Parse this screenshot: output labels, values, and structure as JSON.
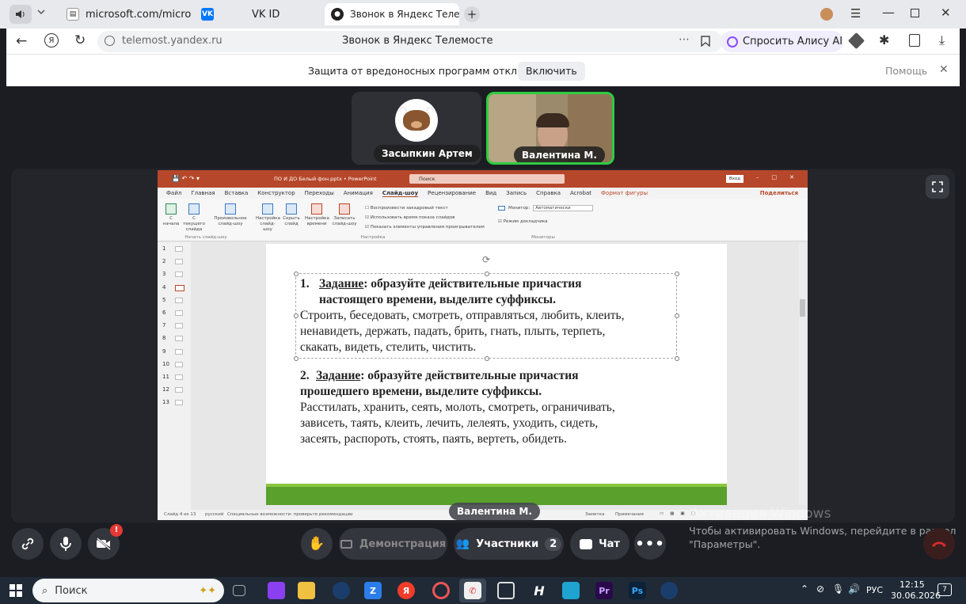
{
  "browser": {
    "tabs": [
      {
        "label": "microsoft.com/microsoft-"
      },
      {
        "label": "VK ID"
      },
      {
        "label": "Звонок в Яндекс Телеме"
      }
    ],
    "url": "telemost.yandex.ru",
    "page_title": "Звонок в Яндекс Телемосте",
    "alice_label": "Спросить Алису AI"
  },
  "notice": {
    "text": "Защита от вредоносных программ отключена",
    "enable_label": "Включить",
    "help_label": "Помощь"
  },
  "participants": [
    {
      "name": "Засыпкин Артем"
    },
    {
      "name": "Валентина М."
    }
  ],
  "presenter_label": "Валентина М.",
  "powerpoint": {
    "filename": "ПО И ДО Белый фон.pptx  •  PowerPoint",
    "search_placeholder": "Поиск",
    "login_label": "Вход",
    "menu": [
      "Файл",
      "Главная",
      "Вставка",
      "Конструктор",
      "Переходы",
      "Анимация",
      "Слайд-шоу",
      "Рецензирование",
      "Вид",
      "Запись",
      "Справка",
      "Acrobat",
      "Формат фигуры"
    ],
    "share_label": "Поделиться",
    "ribbon": {
      "btn_from_start": "С начала",
      "btn_from_current": "С текущего слайда",
      "btn_custom": "Произвольное слайд-шоу",
      "group_start": "Начать слайд-шоу",
      "btn_setup": "Настройка слайд-шоу",
      "btn_hide": "Скрыть слайд",
      "btn_rehearse": "Настройка времени",
      "btn_record": "Записать слайд-шоу",
      "check_narration": "Воспроизвести закадровый текст",
      "check_timings": "Использовать время показа слайдов",
      "check_media": "Показать элементы управления проигрывателем",
      "group_setup": "Настройка",
      "monitor_label": "Монитор:",
      "monitor_value": "Автоматически",
      "presenter_view": "Режим докладчика",
      "group_monitors": "Мониторы"
    },
    "slide_numbers": [
      "1",
      "2",
      "3",
      "4",
      "5",
      "6",
      "7",
      "8",
      "9",
      "10",
      "11",
      "12",
      "13"
    ],
    "slide": {
      "task1_num": "1.",
      "task1_word": "Задание",
      "task1_line1": ": образуйте действительные причастия",
      "task1_line2": "настоящего времени, выделите суффиксы.",
      "task1_words_1": "Строить, беседовать, смотреть, отправляться, любить, клеить,",
      "task1_words_2": "ненавидеть, держать, падать, брить, гнать, плыть, терпеть,",
      "task1_words_3": "скакать, видеть, стелить, чистить.",
      "task2_num": "2.",
      "task2_word": "Задание",
      "task2_line1": ": образуйте действительные причастия",
      "task2_line2": "прошедшего времени, выделите суффиксы.",
      "task2_words_1": "Расстилать, хранить, сеять, молоть, смотреть, ограничивать,",
      "task2_words_2": "зависеть, таять, клеить, лечить, лелеять, уходить, сидеть,",
      "task2_words_3": "засеять, распороть, стоять, паять, вертеть, обидеть."
    },
    "status": {
      "slide_info": "Слайд 4 из 13",
      "language": "русский",
      "accessibility": "Специальные возможности: проверьте рекомендации",
      "notes": "Заметка",
      "comments": "Примечания"
    }
  },
  "controls": {
    "demo_label": "Демонстрация",
    "participants_label": "Участники",
    "participants_count": "2",
    "chat_label": "Чат",
    "badge": "!"
  },
  "watermark": {
    "title": "Активация Windows",
    "line1": "Чтобы активировать Windows, перейдите в раздел",
    "line2": "\"Параметры\"."
  },
  "taskbar": {
    "search_label": "Поиск",
    "lang": "РУС",
    "time": "12:15",
    "date": "30.06.2026",
    "notif_count": "7"
  },
  "colors": {
    "ppt_accent": "#b7472a",
    "active_speaker": "#2ecc40",
    "slide_footer": "#5aa02c",
    "hangup": "#e02a2a"
  }
}
